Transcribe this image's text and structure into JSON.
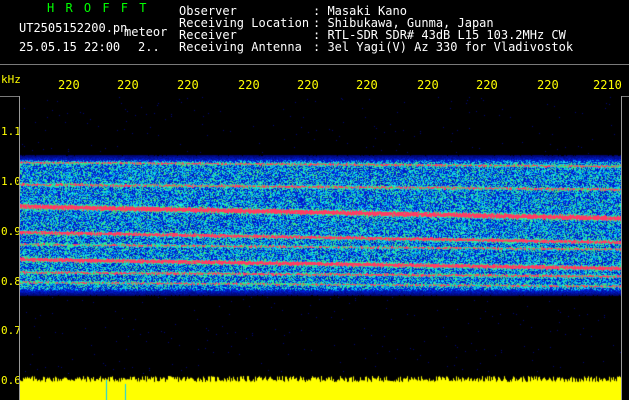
{
  "header": {
    "app_title": "H R O F F T",
    "file_name": "UT2505152200.pn",
    "suffix": "meteor",
    "date_time": "25.05.15 22:00",
    "page_indicator": "2..",
    "info": [
      {
        "label": "Observer",
        "value": ": Masaki Kano"
      },
      {
        "label": "Receiving Location",
        "value": ": Shibukawa, Gunma, Japan"
      },
      {
        "label": "Receiver",
        "value": ": RTL-SDR SDR# 43dB L15 103.2MHz CW"
      },
      {
        "label": "Receiving Antenna",
        "value": ": 3el Yagi(V) Az 330 for Vladivostok"
      }
    ]
  },
  "axis": {
    "y_unit": "kHz",
    "y_ticks": [
      "1.1",
      "1.0",
      "0.9",
      "0.8",
      "0.7",
      "0.6"
    ],
    "x_ticks": [
      "220",
      "220",
      "220",
      "220",
      "220",
      "220",
      "220",
      "220",
      "220",
      "2210"
    ]
  },
  "colors": {
    "background": "#000000",
    "header_text": "#ffffff",
    "title_text": "#00ff00",
    "axis_text": "#ffff00",
    "level_bar": "#ffff00",
    "meteor_trail": "#ff3355"
  }
}
